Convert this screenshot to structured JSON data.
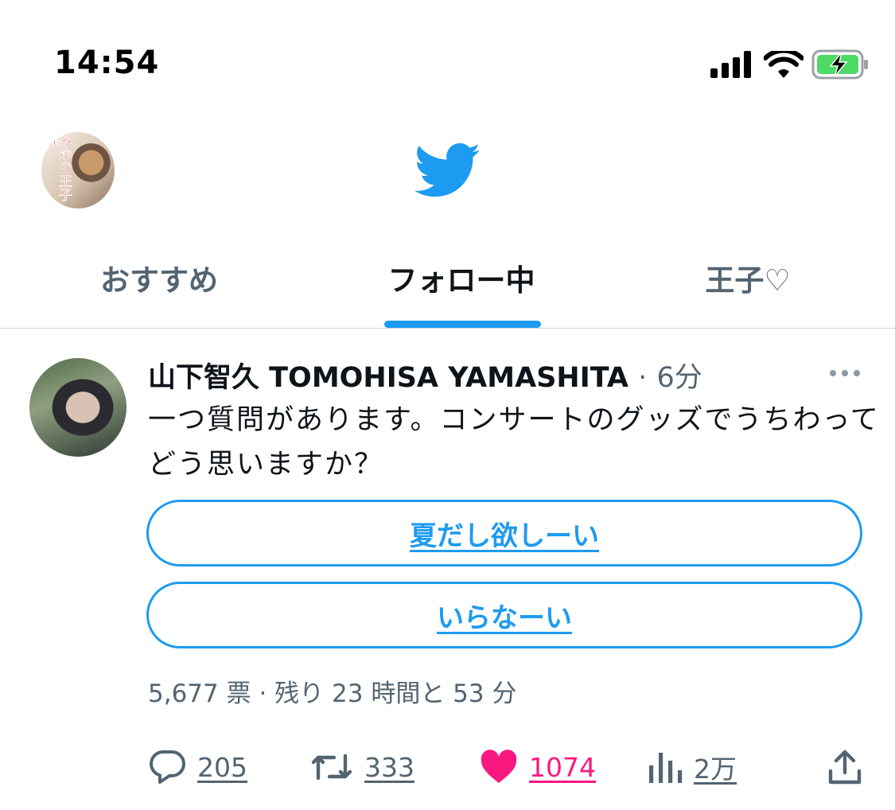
{
  "status_bar": {
    "time": "14:54"
  },
  "header": {
    "profile_sticker": "みゆの王子様"
  },
  "tabs": [
    {
      "label": "おすすめ"
    },
    {
      "label": "フォロー中"
    },
    {
      "label": "王子♡"
    }
  ],
  "tweet": {
    "author": "山下智久 TOMOHISA YAMASHITA",
    "separator": "·",
    "time_ago": "6分",
    "text": "一つ質問があります。コンサートのグッズでうちわってどう思いますか？",
    "poll": {
      "options": [
        "夏だし欲しーい",
        "いらなーい"
      ],
      "status": "5,677 票 · 残り 23 時間と 53 分"
    },
    "actions": {
      "replies": "205",
      "retweets": "333",
      "likes": "1074",
      "views": "2万"
    }
  },
  "colors": {
    "accent": "#1d9bf0",
    "like": "#f91880",
    "secondary_text": "#536471",
    "battery_fill": "#4cd964"
  }
}
